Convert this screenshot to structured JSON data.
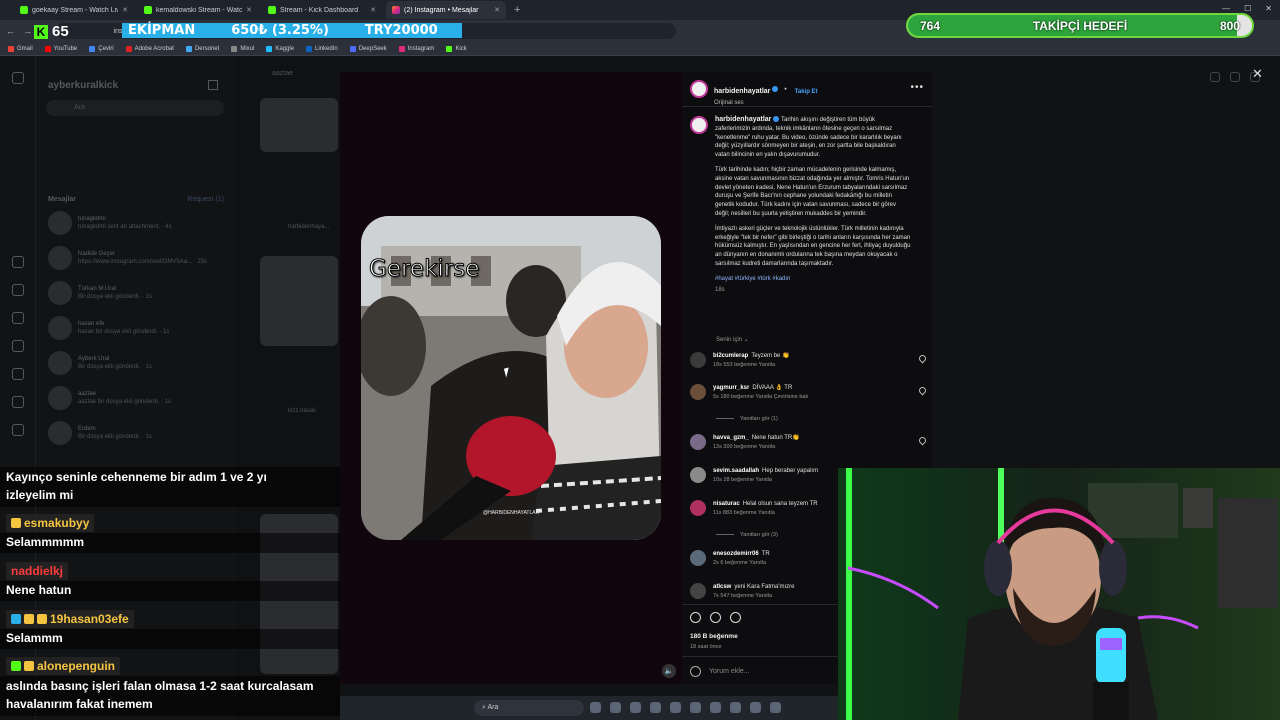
{
  "browser": {
    "tabs": [
      {
        "label": "goekaay Stream - Watch Live o",
        "active": false,
        "icon": "kick-icon"
      },
      {
        "label": "kemaldowski Stream - Watch Li",
        "active": false,
        "icon": "kick-icon"
      },
      {
        "label": "Stream - Kick Dashboard",
        "active": false,
        "icon": "kick-icon"
      },
      {
        "label": "(2) Instagram • Mesajlar",
        "active": true,
        "icon": "instagram-icon"
      }
    ],
    "url": "instagram.com",
    "bookmarks": [
      {
        "label": "Gmail",
        "color": "#ea4335"
      },
      {
        "label": "YouTube",
        "color": "#ff0000"
      },
      {
        "label": "Çeviri",
        "color": "#4285f4"
      },
      {
        "label": "Adobe Acrobat",
        "color": "#e02020"
      },
      {
        "label": "Dersonet",
        "color": "#3fa9f5"
      },
      {
        "label": "Mixul",
        "color": "#888888"
      },
      {
        "label": "Kaggle",
        "color": "#20beff"
      },
      {
        "label": "LinkedIn",
        "color": "#0a66c2"
      },
      {
        "label": "DeepSeek",
        "color": "#4d6bfe"
      },
      {
        "label": "Instagram",
        "color": "#dd2a7b"
      },
      {
        "label": "Kick",
        "color": "#53fc18"
      }
    ]
  },
  "stream_overlay": {
    "kick_count": "65",
    "ticker": {
      "item": "EKİPMAN",
      "change": "650₺ (3.25%)",
      "goal": "TRY20000"
    },
    "follower_goal": {
      "current": "764",
      "label": "TAKİPÇİ HEDEFİ",
      "target": "800",
      "progress": 0.955
    }
  },
  "instagram": {
    "inbox": {
      "username": "ayberkuralkick",
      "search_placeholder": "Ara",
      "section": "Mesajlar",
      "requests": "Request (1)",
      "threads": [
        {
          "name": "tunagkdmi",
          "preview": "tunagkdmi sent an attachment. · 4s"
        },
        {
          "name": "Nadide Geçer",
          "preview": "https://www.instagram.com/reel/DMV5Aa... · 25s"
        },
        {
          "name": "Türkan M.Ural",
          "preview": "Bir dosya ekli gönderdi. · 1s"
        },
        {
          "name": "hasan efe",
          "preview": "hasan bir dosya ekli gönderdi. · 1s"
        },
        {
          "name": "Ayberk Ural",
          "preview": "Bir dosya ekli gönderdi. · 1s"
        },
        {
          "name": "aaztae",
          "preview": "aaztae bir dosya ekli gönderdi. · 1s"
        },
        {
          "name": "Erdem",
          "preview": "Bir dosya ekli gönderdi. · 1s"
        }
      ]
    },
    "chat": {
      "name": "aaztae",
      "shared_name": "harbidenhaya...",
      "shared_name2": "kizz.nasali"
    },
    "post": {
      "author": "harbidenhayatlar",
      "follow": "Takip Et",
      "audio": "Orijinal ses",
      "video_caption": "Gerekirse",
      "watermark": "@HARBIDENHAYATLAR",
      "caption": [
        "Tarihin akışını değiştiren tüm büyük zaferlerimizin ardında, teknik imkânların ötesine geçen o sarsılmaz \"kenetlenme\" ruhu yatar. Bu video, özünde sadece bir kararlılık beyanı değil; yüzyıllardır sönmeyen bir ateşin, en zor şartta bile başkaldıran vatan bilincinin en yalın dışavurumudur.",
        "Türk tarihinde kadın; hiçbir zaman mücadelenin gerisinde kalmamış, aksine vatan savunmasının bizzat odağında yer almıştır. Tomris Hatun'un devlet yöneten iradesi, Nene Hatun'un Erzurum tabyalarındaki sarsılmaz duruşu ve Şerife Bacı'nın cephane yolundaki fedakârlığı bu milletin genetik kodudur. Türk kadını için vatan savunması, sadece bir görev değil; nesilleri bu şuurla yetiştiren mukaddes bir yemindir.",
        "İmtiyazlı askeri güçler ve teknolojik üstünlükler. Türk milletinin kadınıyla erkeğiyle \"tek bir nefer\" gibi birleştiği o tarihi anların karşısında her zaman hükümsüz kalmıştır. En yaşlısından en gencine her fert, ihtiyaç duyulduğu an dünyanın en donanımlı ordularına tek başına meydan okuyacak o sarsılmaz kudreti damarlarında taşımaktadır."
      ],
      "hashtags": "#hayat #türkiye #türk #kadın",
      "age": "18s",
      "for_you": "Senin için",
      "comments": [
        {
          "user": "bi2cumlerap",
          "text": "Teyzem be 👏",
          "meta": "18s   553 beğenme   Yanıtla",
          "avatar": "#3a3a3a"
        },
        {
          "user": "yagmurr_ksr",
          "text": "DİVAAA 👌 TR",
          "meta": "5s   180 beğenme   Yanıtla   Çevirisine bak",
          "avatar": "#6b4f3a"
        },
        {
          "user": "havva_gzm_",
          "text": "Nene hatun TR👏",
          "meta": "13s   300 beğenme   Yanıtla",
          "avatar": "#7a6a8a"
        },
        {
          "user": "sevim.saadallah",
          "text": "Hep beraber yapalım",
          "meta": "10s   28 beğenme   Yanıtla",
          "avatar": "#8a8a8a"
        },
        {
          "user": "nisaturac",
          "text": "Helal olsun sana teyzem TR",
          "meta": "11s   883 beğenme   Yanıtla",
          "avatar": "#b03060"
        },
        {
          "user": "enesozdemirr06",
          "text": "TR",
          "meta": "2s   6 beğenme   Yanıtla",
          "avatar": "#5a6a7a"
        },
        {
          "user": "atlcsw",
          "text": "yeni Kara Fatma'mızre",
          "meta": "7s   547 beğenme   Yanıtla",
          "avatar": "#444444"
        }
      ],
      "view_replies_1": "Yanıtları gör (1)",
      "view_replies_3": "Yanıtları gör (3)",
      "likes": "180 B beğenme",
      "posted": "18 saat önce",
      "comment_placeholder": "Yorum ekle..."
    }
  },
  "stream_chat": {
    "lines": [
      {
        "user": "",
        "text": "Kayınço seninle cehenneme bir adım 1 ve 2 yı izleyelim mi"
      },
      {
        "user": "esmakubyy",
        "text": "Selammmmm",
        "color": "#f5c542"
      },
      {
        "user": "naddielkj",
        "text": "Nene hatun",
        "color": "#ff3b3b"
      },
      {
        "user": "19hasan03efe",
        "text": "Selammm",
        "color": "#f5c542"
      },
      {
        "user": "alonepenguin",
        "text": "aslında basınç işleri falan olmasa 1-2 saat kurcalasam havalanırım fakat inemem",
        "color": "#f5c542"
      }
    ]
  },
  "taskbar": {
    "search": "Ara"
  }
}
